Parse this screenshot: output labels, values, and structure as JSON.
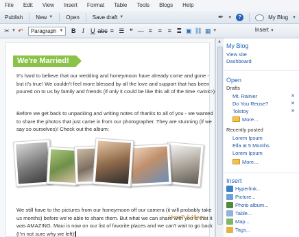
{
  "menu": [
    "File",
    "Edit",
    "View",
    "Insert",
    "Format",
    "Table",
    "Tools",
    "Blogs",
    "Help"
  ],
  "toolbar": {
    "publish": "Publish",
    "new": "New",
    "open": "Open",
    "save_draft": "Save draft",
    "blog_name": "My Blog"
  },
  "format_bar": {
    "style": "Paragraph",
    "insert": "Insert"
  },
  "post": {
    "title": "We're Married!",
    "para1": "It's hard to believe that our wedding and honeymoon have already come and gone - but it's true!  We couldn't feel more blessed by all the love and support that has been poured on to us by family and friends (if only it could be like this all of the time <wink>)!",
    "para2": "Before we get back to unpacking and writing notes of thanks to all of you - we wanted to share the photos that just came in from our photographer.  They are stunning (if we say so ourselves)!  Check out the album:",
    "view_album": "View Full Album",
    "para3": "We still have to the pictures from our honeymoon off our camera (it will probably take us months) before we're able to share them.  But what we can share with you is that it was AMAZING.  Maui is now on our list of favorite places and we can't wait to go back (I'm not sure why we left)!"
  },
  "sidebar": {
    "blog_heading": "My Blog",
    "view_site": "View site",
    "dashboard": "Dashboard",
    "open_heading": "Open",
    "drafts_label": "Drafts",
    "drafts": [
      "Mt. Rainier",
      "Do You Reuse?",
      "Tolstoy"
    ],
    "more1": "More...",
    "recent_label": "Recently posted",
    "recent": [
      "Lorem Ipsum",
      "Ella at 5 Months",
      "Lorem Ipsum"
    ],
    "more2": "More...",
    "insert_heading": "Insert",
    "insert_items": [
      "Hyperlink...",
      "Picture...",
      "Photo album...",
      "Table...",
      "Map...",
      "Tags..."
    ]
  },
  "colors": {
    "banner": "#8bc34a",
    "link": "#1e56a5",
    "album_link": "#e08a1a"
  }
}
